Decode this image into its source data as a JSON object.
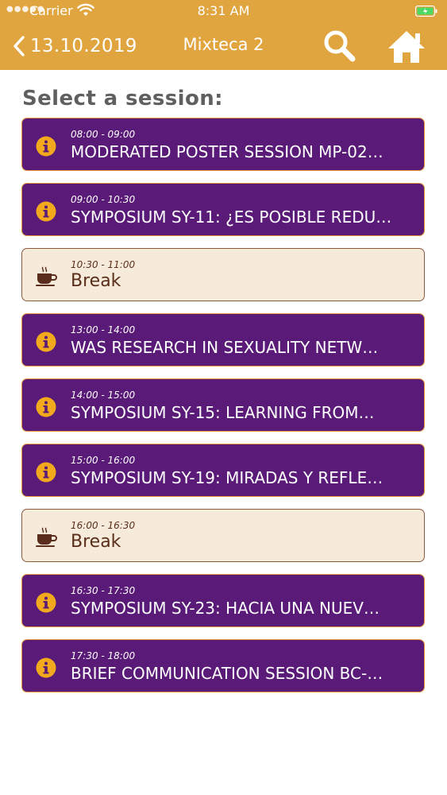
{
  "status_bar": {
    "carrier": "Carrier",
    "time": "8:31 AM"
  },
  "nav": {
    "back_label": "13.10.2019",
    "title": "Mixteca 2"
  },
  "heading": "Select a session:",
  "colors": {
    "header": "#e1a540",
    "session_bg": "#5a1a78",
    "session_border": "#e29a3c",
    "break_bg": "#f6eadb",
    "info_icon": "#f2a91e"
  },
  "sessions": [
    {
      "type": "session",
      "icon": "info-icon",
      "time": "08:00 - 09:00",
      "title": "MODERATED POSTER SESSION MP-02…"
    },
    {
      "type": "session",
      "icon": "info-icon",
      "time": "09:00 - 10:30",
      "title": "SYMPOSIUM SY-11: ¿ES POSIBLE REDU…"
    },
    {
      "type": "break",
      "icon": "coffee-cup-icon",
      "time": "10:30 - 11:00",
      "title": "Break"
    },
    {
      "type": "session",
      "icon": "info-icon",
      "time": "13:00 - 14:00",
      "title": "WAS  RESEARCH IN SEXUALITY NETW…"
    },
    {
      "type": "session",
      "icon": "info-icon",
      "time": "14:00 - 15:00",
      "title": "SYMPOSIUM SY-15: LEARNING FROM…"
    },
    {
      "type": "session",
      "icon": "info-icon",
      "time": "15:00 - 16:00",
      "title": "SYMPOSIUM SY-19: MIRADAS Y REFLE…"
    },
    {
      "type": "break",
      "icon": "coffee-cup-icon",
      "time": "16:00 - 16:30",
      "title": "Break"
    },
    {
      "type": "session",
      "icon": "info-icon",
      "time": "16:30 - 17:30",
      "title": "SYMPOSIUM SY-23: HACIA UNA NUEV…"
    },
    {
      "type": "session",
      "icon": "info-icon",
      "time": "17:30 - 18:00",
      "title": "BRIEF COMMUNICATION SESSION BC-…"
    }
  ]
}
